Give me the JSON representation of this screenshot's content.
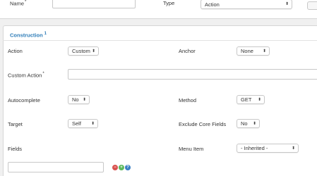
{
  "header": {
    "name_label": "Name",
    "name_required_mark": "*",
    "name_value": "",
    "type_label": "Type",
    "type_value": "Action"
  },
  "section": {
    "title": "Construction",
    "title_sup": "1"
  },
  "fields": {
    "action": {
      "label": "Action",
      "value": "Custom"
    },
    "anchor": {
      "label": "Anchor",
      "value": "None"
    },
    "custom_action": {
      "label": "Custom Action",
      "required_mark": "*",
      "value": ""
    },
    "autocomplete": {
      "label": "Autocomplete",
      "value": "No"
    },
    "method": {
      "label": "Method",
      "value": "GET"
    },
    "target": {
      "label": "Target",
      "value": "Self"
    },
    "exclude_core_fields": {
      "label": "Exclude Core Fields",
      "value": "No"
    },
    "fields": {
      "label": "Fields",
      "value": ""
    },
    "menu_item": {
      "label": "Menu Item",
      "value": "- Inherited -"
    }
  },
  "select_arrows": "⬍",
  "row_actions": {
    "remove_glyph": "−",
    "add_glyph": "+",
    "help_glyph": "?"
  },
  "colors": {
    "accent": "#2d7cb8",
    "remove": "#d9534f",
    "add": "#5cb85c",
    "help": "#3a7fc4"
  }
}
